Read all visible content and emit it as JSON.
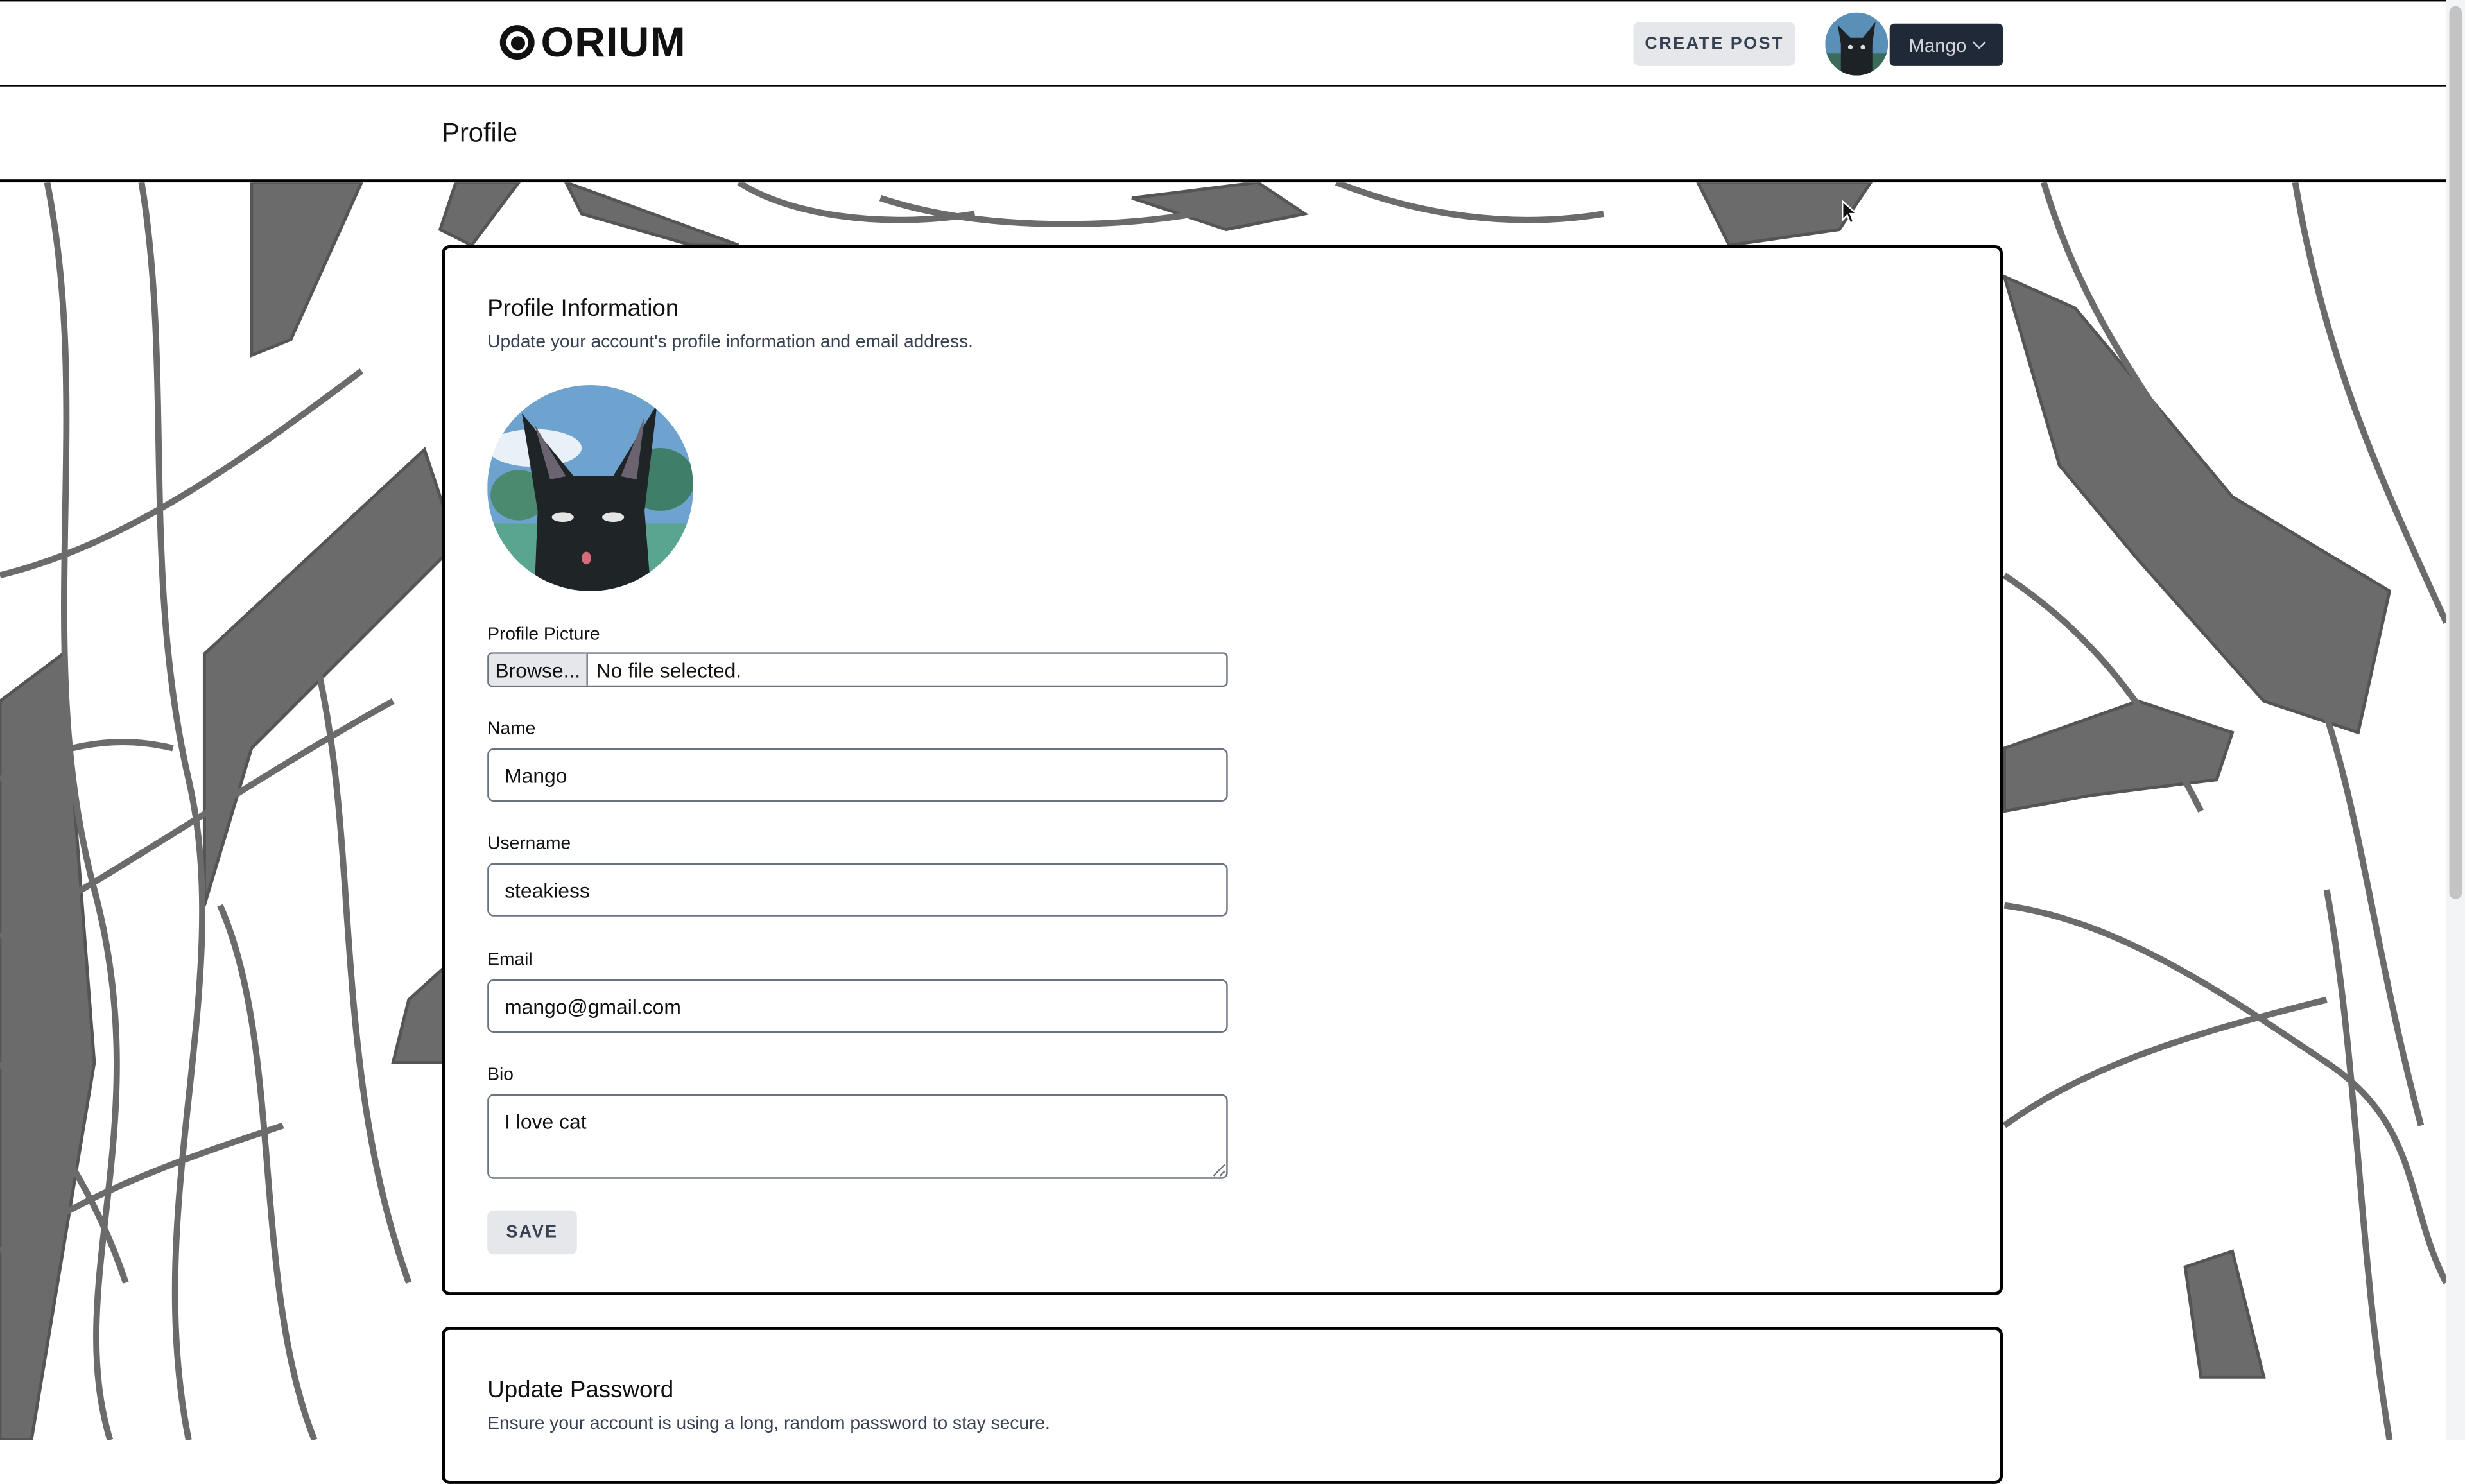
{
  "nav": {
    "logo_text": "ORIUM",
    "create_post_label": "CREATE POST",
    "user_name": "Mango"
  },
  "header": {
    "title": "Profile"
  },
  "profile_info": {
    "title": "Profile Information",
    "description": "Update your account's profile information and email address.",
    "picture_label": "Profile Picture",
    "browse_label": "Browse...",
    "file_status": "No file selected.",
    "name_label": "Name",
    "name_value": "Mango",
    "username_label": "Username",
    "username_value": "steakiess",
    "email_label": "Email",
    "email_value": "mango@gmail.com",
    "bio_label": "Bio",
    "bio_value": "I love cat",
    "save_label": "SAVE"
  },
  "update_password": {
    "title": "Update Password",
    "description": "Ensure your account is using a long, random password to stay secure."
  },
  "colors": {
    "nav_button": "#1f2937",
    "button_bg": "#e5e7eb",
    "background_pattern": "#6b6b6b"
  }
}
